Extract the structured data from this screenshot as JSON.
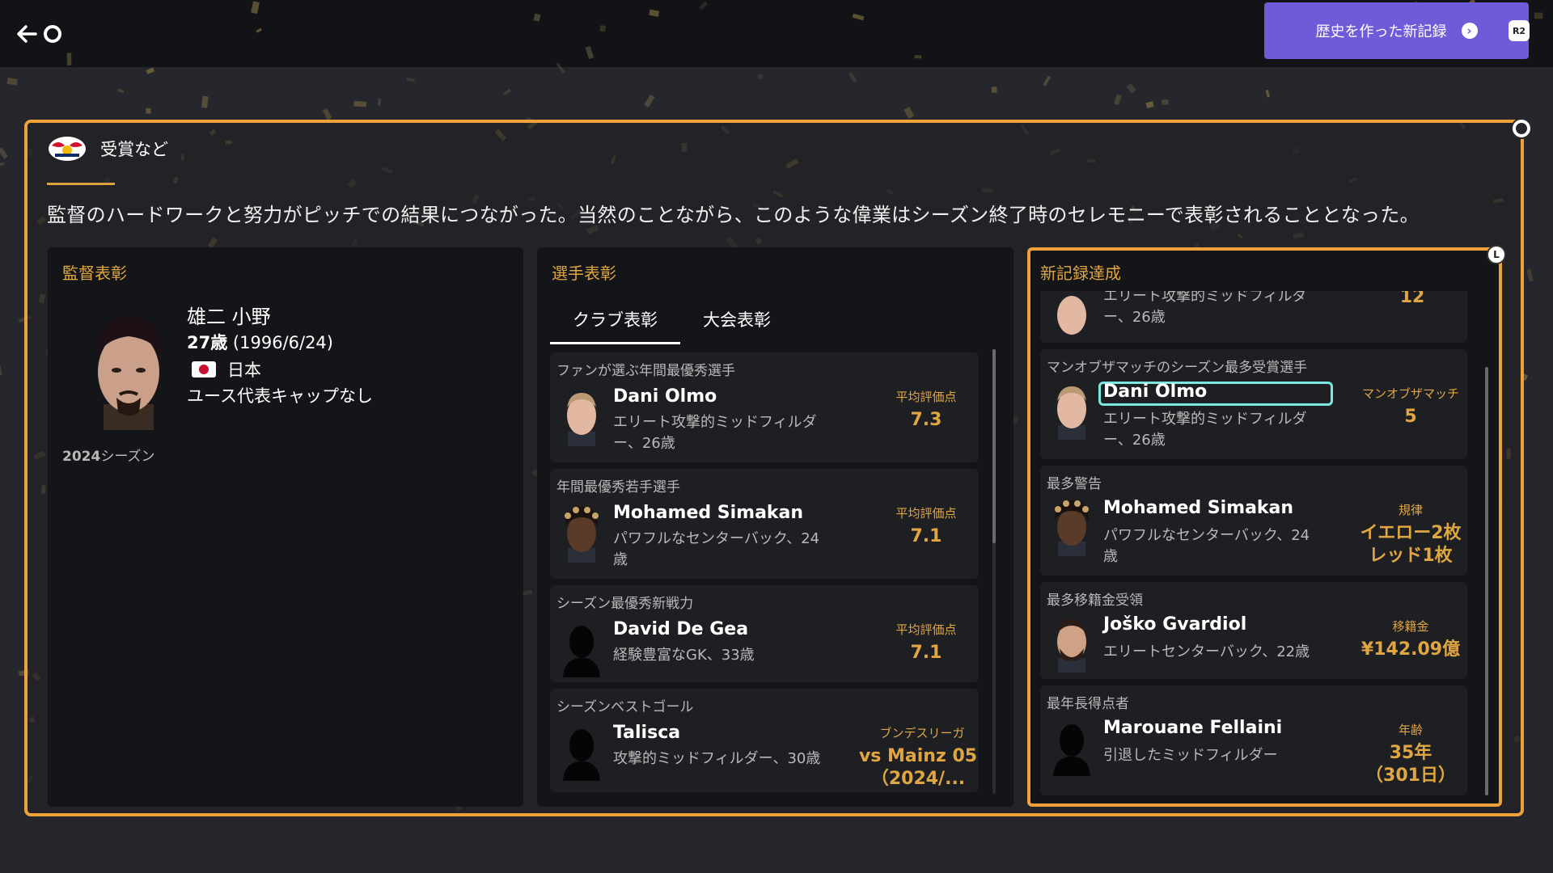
{
  "header": {
    "records_button_label": "歴史を作った新記録",
    "r2_label": "R2"
  },
  "section": {
    "title": "受賞など",
    "intro": "監督のハードワークと努力がピッチでの結果につながった。当然のことながら、このような偉業はシーズン終了時のセレモニーで表彰されることとなった。"
  },
  "manager": {
    "panel_title": "監督表彰",
    "name": "雄二 小野",
    "age": "27歳",
    "birth": "(1996/6/24)",
    "nationality": "日本",
    "caps": "ユース代表キャップなし",
    "season_year": "2024",
    "season_suffix": "シーズン"
  },
  "players": {
    "panel_title": "選手表彰",
    "tabs": [
      {
        "label": "クラブ表彰",
        "active": true
      },
      {
        "label": "大会表彰",
        "active": false
      }
    ],
    "cards": [
      {
        "category": "ファンが選ぶ年間最優秀選手",
        "name": "Dani Olmo",
        "desc": "エリート攻撃的ミッドフィルダー、26歳",
        "stat_label": "平均評価点",
        "stat_value": "7.3"
      },
      {
        "category": "年間最優秀若手選手",
        "name": "Mohamed Simakan",
        "desc": "パワフルなセンターバック、24歳",
        "stat_label": "平均評価点",
        "stat_value": "7.1"
      },
      {
        "category": "シーズン最優秀新戦力",
        "name": "David De Gea",
        "desc": "経験豊富なGK、33歳",
        "stat_label": "平均評価点",
        "stat_value": "7.1"
      },
      {
        "category": "シーズンベストゴール",
        "name": "Talisca",
        "desc": "攻撃的ミッドフィルダー、30歳",
        "stat_label": "ブンデスリーガ",
        "stat_value": "vs Mainz 05（2024/..."
      }
    ]
  },
  "records": {
    "panel_title": "新記録達成",
    "l_badge": "L",
    "partial_card": {
      "desc": "エリート攻撃的ミッドフィルダー、26歳",
      "stat_value": "12"
    },
    "cards": [
      {
        "category": "マンオブザマッチのシーズン最多受賞選手",
        "name": "Dani Olmo",
        "desc": "エリート攻撃的ミッドフィルダー、26歳",
        "stat_label": "マンオブザマッチ",
        "stat_value": "5"
      },
      {
        "category": "最多警告",
        "name": "Mohamed Simakan",
        "desc": "パワフルなセンターバック、24歳",
        "stat_label": "規律",
        "stat_value": "イエロー2枚 レッド1枚"
      },
      {
        "category": "最多移籍金受領",
        "name": "Joško Gvardiol",
        "desc": "エリートセンターバック、22歳",
        "stat_label": "移籍金",
        "stat_value": "¥142.09億"
      },
      {
        "category": "最年長得点者",
        "name": "Marouane Fellaini",
        "desc": "引退したミッドフィルダー",
        "stat_label": "年齢",
        "stat_value": "35年（301日）"
      }
    ]
  },
  "colors": {
    "accent_gold": "#e0a642",
    "frame_orange": "#f0a23a",
    "button_purple": "#6d5bd7",
    "highlight_cyan": "#7be7df"
  }
}
